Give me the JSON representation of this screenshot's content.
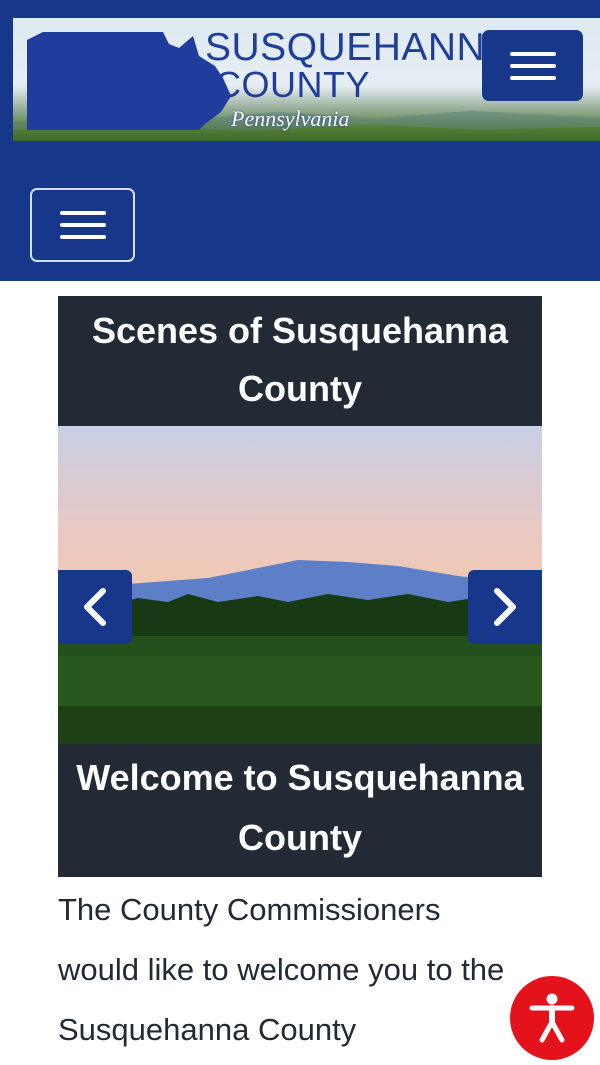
{
  "header": {
    "title_line1": "SUSQUEHANNA",
    "title_line2": "COUNTY",
    "title_line3": "Pennsylvania",
    "brand_color": "#17378a"
  },
  "carousel": {
    "title": "Scenes of Susquehanna County",
    "caption": "Welcome to Susquehanna County"
  },
  "intro_text": "The County Commissioners would like to welcome you to the Susquehanna County",
  "accessibility_color": "#e3121b"
}
